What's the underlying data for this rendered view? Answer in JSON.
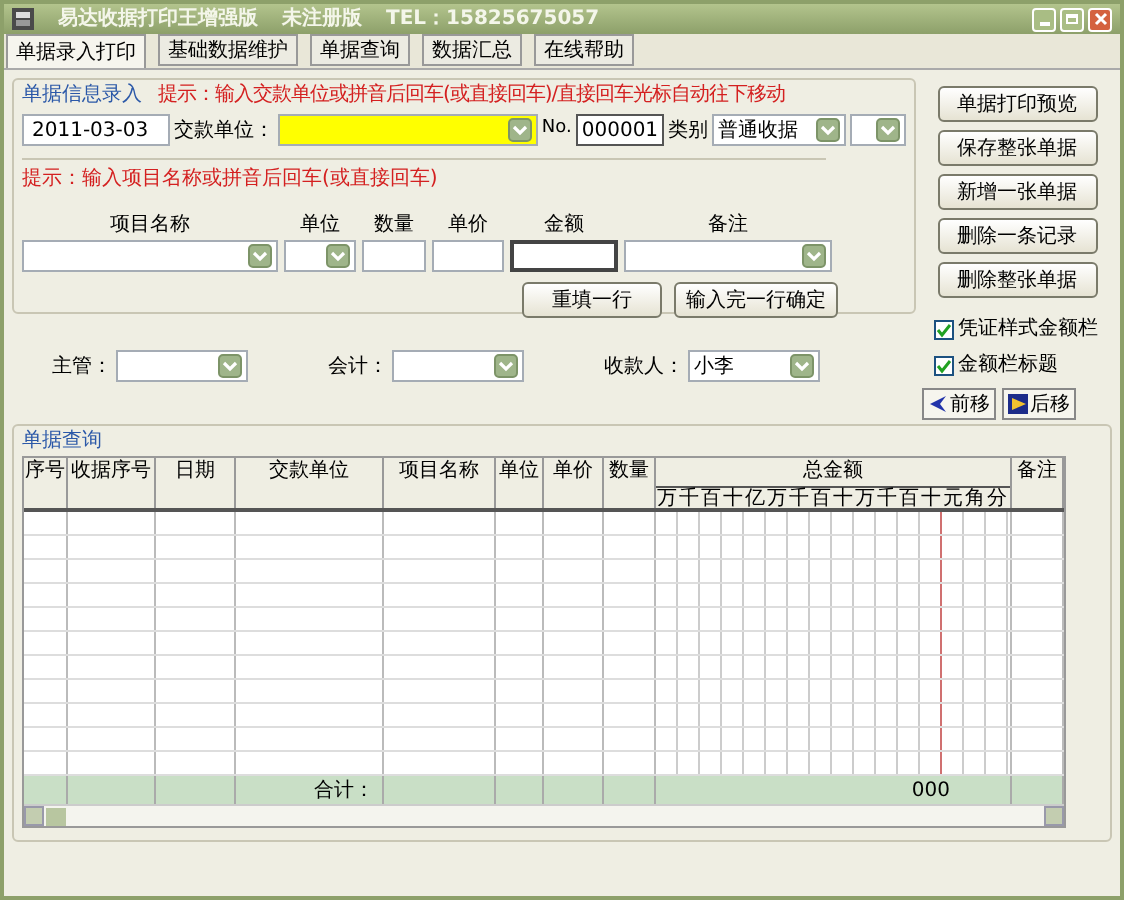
{
  "window": {
    "title_parts": [
      "易达收据打印王增强版",
      "未注册版",
      "TEL：15825675057"
    ]
  },
  "tabs": [
    {
      "label": "单据录入打印",
      "selected": true
    },
    {
      "label": "基础数据维护",
      "selected": false
    },
    {
      "label": "单据查询",
      "selected": false
    },
    {
      "label": "数据汇总",
      "selected": false
    },
    {
      "label": "在线帮助",
      "selected": false
    }
  ],
  "entry": {
    "title": "单据信息录入",
    "hint": "提示：输入交款单位或拼音后回车(或直接回车)/直接回车光标自动往下移动",
    "date": "2011-03-03",
    "payer_label": "交款单位：",
    "number_label": "No.",
    "number": "000001",
    "category_label": "类别",
    "category": "普通收据",
    "item_hint": "提示：输入项目名称或拼音后回车(或直接回车)",
    "item_columns": [
      {
        "label": "项目名称",
        "kind": "combo"
      },
      {
        "label": "单位",
        "kind": "combo"
      },
      {
        "label": "数量",
        "kind": "input"
      },
      {
        "label": "单价",
        "kind": "input"
      },
      {
        "label": "金额",
        "kind": "framed"
      },
      {
        "label": "备注",
        "kind": "combo"
      }
    ],
    "buttons": [
      "重填一行",
      "输入完一行确定"
    ]
  },
  "signatures": [
    {
      "label": "主管："
    },
    {
      "label": "会计："
    },
    {
      "label": "收款人：",
      "value": "小李"
    }
  ],
  "actions": [
    "单据打印预览",
    "保存整张单据",
    "新增一张单据",
    "删除一条记录",
    "删除整张单据"
  ],
  "options": [
    {
      "label": "凭证样式金额栏",
      "checked": true
    },
    {
      "label": "金额栏标题",
      "checked": true
    }
  ],
  "nav": [
    {
      "label": "前移",
      "kind": "prev"
    },
    {
      "label": "后移",
      "kind": "next"
    }
  ],
  "query": {
    "title": "单据查询",
    "columns": [
      {
        "label": "序号",
        "kind": "text"
      },
      {
        "label": "收据序号",
        "kind": "text"
      },
      {
        "label": "日期",
        "kind": "text"
      },
      {
        "label": "交款单位",
        "kind": "text"
      },
      {
        "label": "项目名称",
        "kind": "text"
      },
      {
        "label": "单位",
        "kind": "text"
      },
      {
        "label": "单价",
        "kind": "text"
      },
      {
        "label": "数量",
        "kind": "text"
      },
      {
        "label": "总金额",
        "kind": "amount"
      },
      {
        "label": "备注",
        "kind": "text"
      }
    ],
    "amount_digits": [
      "万",
      "千",
      "百",
      "十",
      "亿",
      "万",
      "千",
      "百",
      "十",
      "万",
      "千",
      "百",
      "十",
      "元",
      "角",
      "分"
    ],
    "total_label": "合计：",
    "total": "000"
  }
}
